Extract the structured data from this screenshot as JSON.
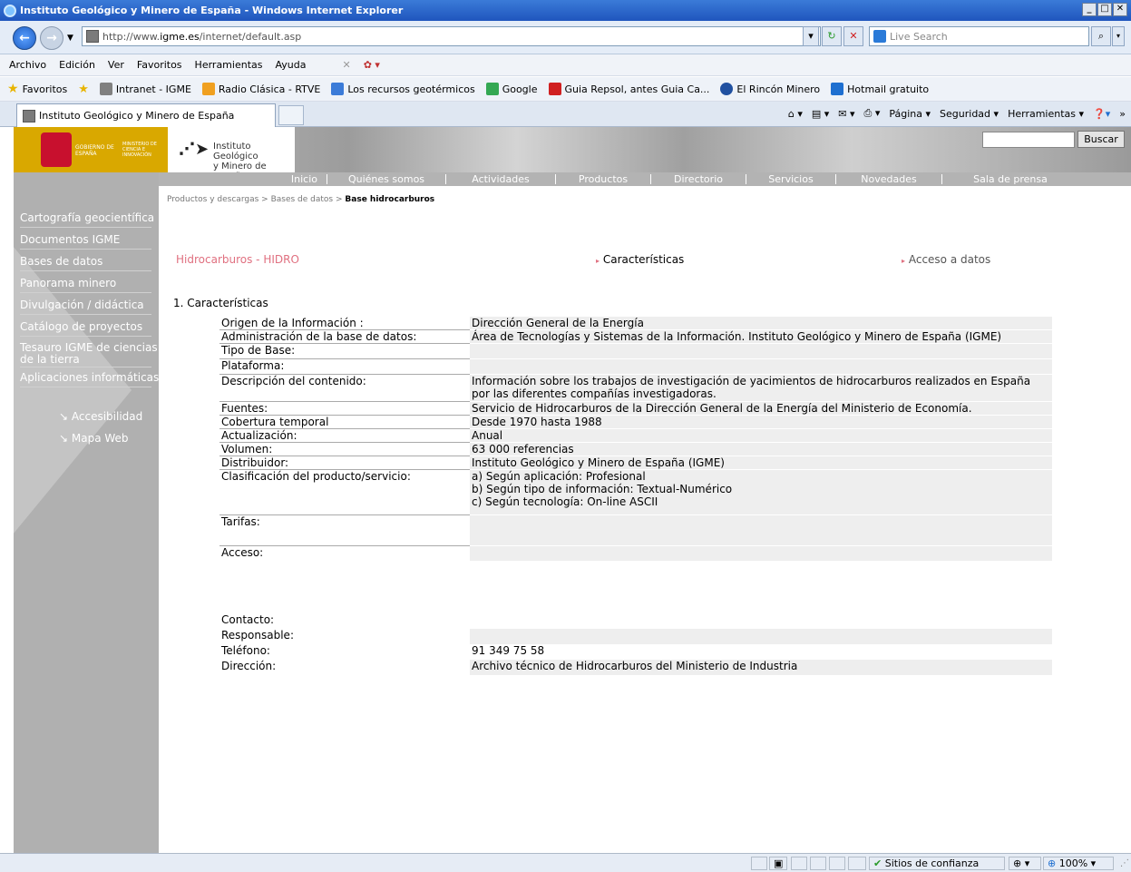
{
  "window": {
    "title": "Instituto Geológico y Minero de España - Windows Internet Explorer"
  },
  "address": {
    "url_prefix": "http://www.",
    "url_domain": "igme.es",
    "url_path": "/internet/default.asp",
    "search_placeholder": "Live Search"
  },
  "menu": [
    "Archivo",
    "Edición",
    "Ver",
    "Favoritos",
    "Herramientas",
    "Ayuda"
  ],
  "favorites": {
    "label": "Favoritos",
    "items": [
      {
        "label": "Intranet - IGME",
        "color": "#808080"
      },
      {
        "label": "Radio Clásica - RTVE",
        "color": "#f0a020"
      },
      {
        "label": "Los recursos geotérmicos",
        "color": "#3b7bd8"
      },
      {
        "label": "Google",
        "color": "#34a853"
      },
      {
        "label": "Guia Repsol, antes Guia Ca...",
        "color": "#d02020"
      },
      {
        "label": "El Rincón Minero",
        "color": "#2050a0"
      },
      {
        "label": "Hotmail gratuito",
        "color": "#1e6fd0"
      }
    ]
  },
  "tab": {
    "title": "Instituto Geológico y Minero de España"
  },
  "commandbar": {
    "pagina": "Página",
    "seguridad": "Seguridad",
    "herramientas": "Herramientas"
  },
  "banner": {
    "gobierno": "GOBIERNO DE ESPAÑA",
    "ministerio": "MINISTERIO DE CIENCIA E INNOVACIÓN",
    "igme_line1": "Instituto Geológico",
    "igme_line2": "y Minero de España",
    "search_button": "Buscar"
  },
  "topnav": [
    "Inicio",
    "Quiénes somos",
    "Actividades",
    "Productos",
    "Directorio",
    "Servicios",
    "Novedades",
    "Sala de prensa"
  ],
  "sidebar": {
    "items": [
      "Cartografía geocientífica",
      "Documentos IGME",
      "Bases de datos",
      "Panorama minero",
      "Divulgación / didáctica",
      "Catálogo de proyectos",
      "Tesauro IGME de ciencias",
      "de la tierra",
      "Aplicaciones informáticas"
    ],
    "accesibilidad": "Accesibilidad",
    "mapa_web": "Mapa Web"
  },
  "breadcrumb": {
    "part1": "Productos y descargas",
    "sep": ">",
    "part2": "Bases de datos",
    "current": "Base hidrocarburos"
  },
  "header_links": {
    "hidro": "Hidrocarburos   - HIDRO",
    "caracteristicas": "Características",
    "acceso": "Acceso a datos"
  },
  "section_title": "1. Características",
  "info_rows": [
    {
      "key": "Origen de la Información :",
      "value": "Dirección General de la Energía"
    },
    {
      "key": "Administración de la base de datos:",
      "value": "Área de Tecnologías y Sistemas de la Información. Instituto Geológico y Minero de España (IGME)"
    },
    {
      "key": "Tipo de Base:",
      "value": ""
    },
    {
      "key": "Plataforma:",
      "value": ""
    },
    {
      "key": "Descripción del contenido:",
      "value": " Información sobre los trabajos de investigación de yacimientos de hidrocarburos realizados en España por las diferentes compañías investigadoras."
    },
    {
      "key": "Fuentes:",
      "value": "Servicio de Hidrocarburos de la Dirección General de la Energía del Ministerio de Economía."
    },
    {
      "key": "Cobertura temporal",
      "value": "Desde 1970 hasta 1988"
    },
    {
      "key": "Actualización:",
      "value": "Anual"
    },
    {
      "key": "Volumen:",
      "value": "63 000 referencias"
    },
    {
      "key": "Distribuidor:",
      "value": "Instituto Geológico y Minero de España (IGME)"
    }
  ],
  "clasificacion": {
    "key": "Clasificación del producto/servicio:",
    "a": "a) Según aplicación:  Profesional",
    "b": "b) Según tipo de información:  Textual-Numérico",
    "c": "c) Según tecnología: On-line ASCII"
  },
  "tarifas": "Tarifas:",
  "acceso": "Acceso:",
  "contact": [
    {
      "key": "Contacto:",
      "value": ""
    },
    {
      "key": "Responsable:",
      "value": ""
    },
    {
      "key": "Teléfono:",
      "value": "91 349 75 58"
    },
    {
      "key": "Dirección:",
      "value": "Archivo técnico de Hidrocarburos del Ministerio de Industria"
    }
  ],
  "status": {
    "zone": "Sitios de confianza",
    "zoom": "100%"
  }
}
